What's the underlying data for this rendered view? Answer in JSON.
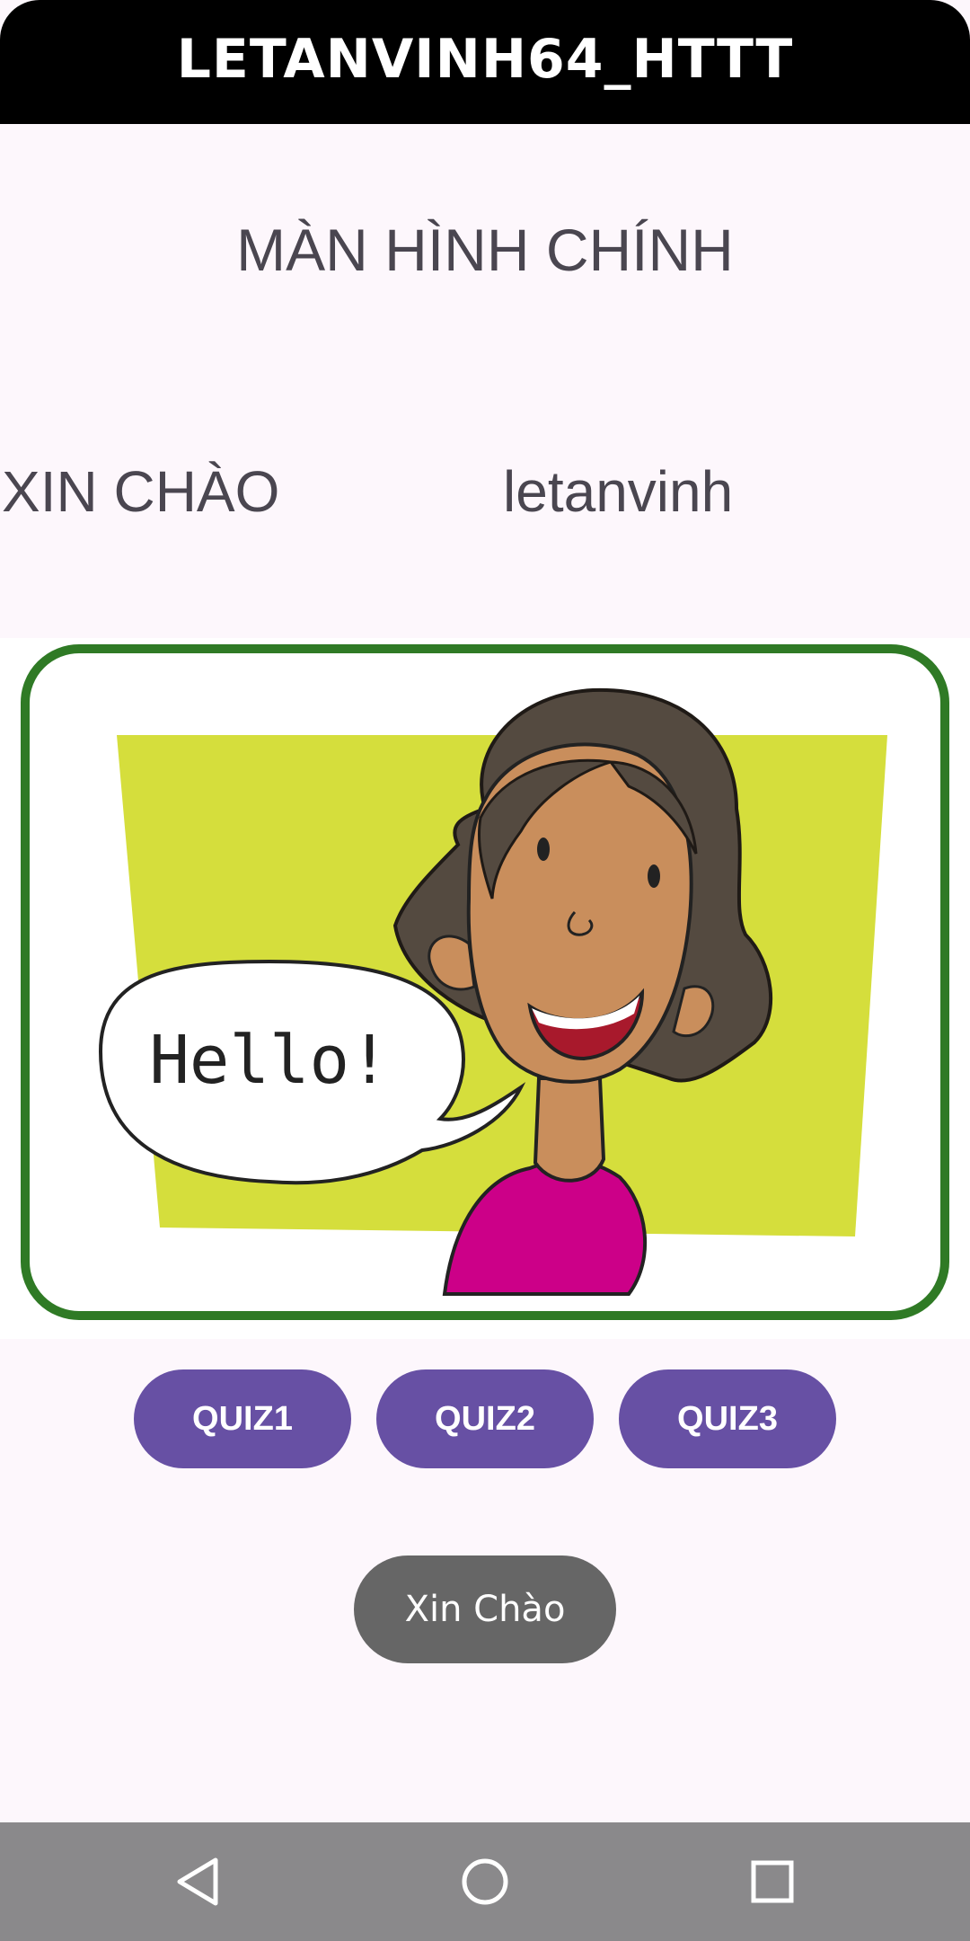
{
  "app_bar": {
    "title": "LETANVINH64_HTTT"
  },
  "main": {
    "heading": "MÀN HÌNH CHÍNH",
    "greeting_label": "XIN CHÀO",
    "username": "letanvinh",
    "illustration": {
      "speech_text": "Hello!"
    },
    "quiz_buttons": [
      {
        "label": "QUIZ1"
      },
      {
        "label": "QUIZ2"
      },
      {
        "label": "QUIZ3"
      }
    ]
  },
  "toast": {
    "text": "Xin Chào"
  },
  "nav_bar": {
    "icons": [
      "back-icon",
      "home-icon",
      "recents-icon"
    ]
  },
  "colors": {
    "app_bar_bg": "#000000",
    "page_bg": "#fdf7fc",
    "button_bg": "#6750a4",
    "toast_bg": "#666666",
    "nav_bar_bg": "#8a898b",
    "frame_green": "#2f7a25",
    "backdrop_yellow_green": "#d5de3c"
  }
}
